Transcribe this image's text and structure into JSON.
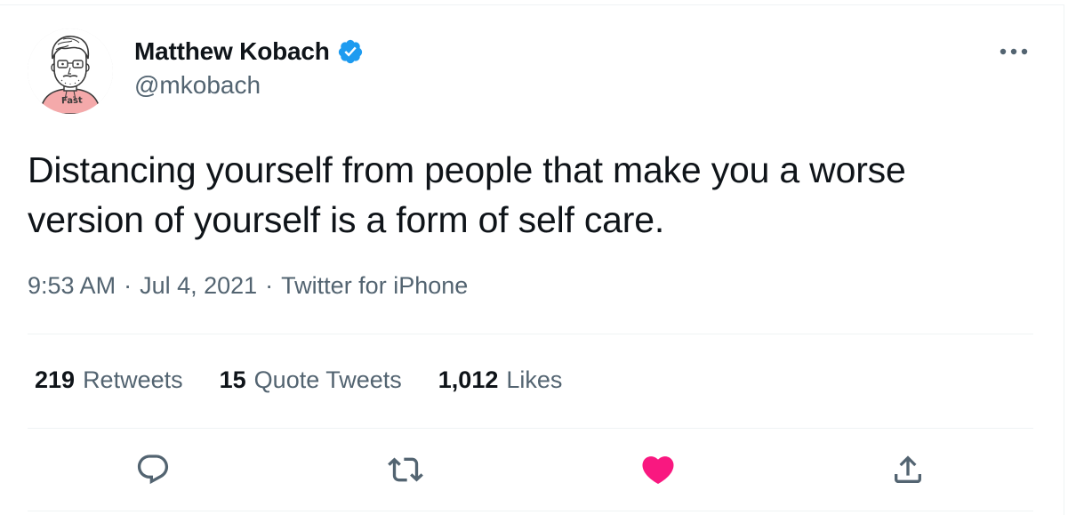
{
  "author": {
    "display_name": "Matthew Kobach",
    "handle": "@mkobach",
    "avatar_badge": "Fast",
    "verified": true
  },
  "tweet": {
    "text": "Distancing yourself from people that make you a worse\nversion of yourself is a form of self care.",
    "time": "9:53 AM",
    "date": "Jul 4, 2021",
    "source": "Twitter for iPhone",
    "separator": "·"
  },
  "stats": {
    "retweets_count": "219",
    "retweets_label": "Retweets",
    "quote_count": "15",
    "quote_label": "Quote Tweets",
    "likes_count": "1,012",
    "likes_label": "Likes"
  },
  "actions": [
    {
      "name": "reply",
      "icon": "speech-bubble-icon"
    },
    {
      "name": "retweet",
      "icon": "retweet-arrows-icon"
    },
    {
      "name": "like",
      "icon": "heart-icon",
      "liked": true
    },
    {
      "name": "share",
      "icon": "share-arrow-icon"
    }
  ],
  "colors": {
    "text_primary": "#0f1419",
    "text_secondary": "#536471",
    "verified_blue": "#1d9bf0",
    "like_pink": "#f91880",
    "divider": "#eff3f4"
  }
}
